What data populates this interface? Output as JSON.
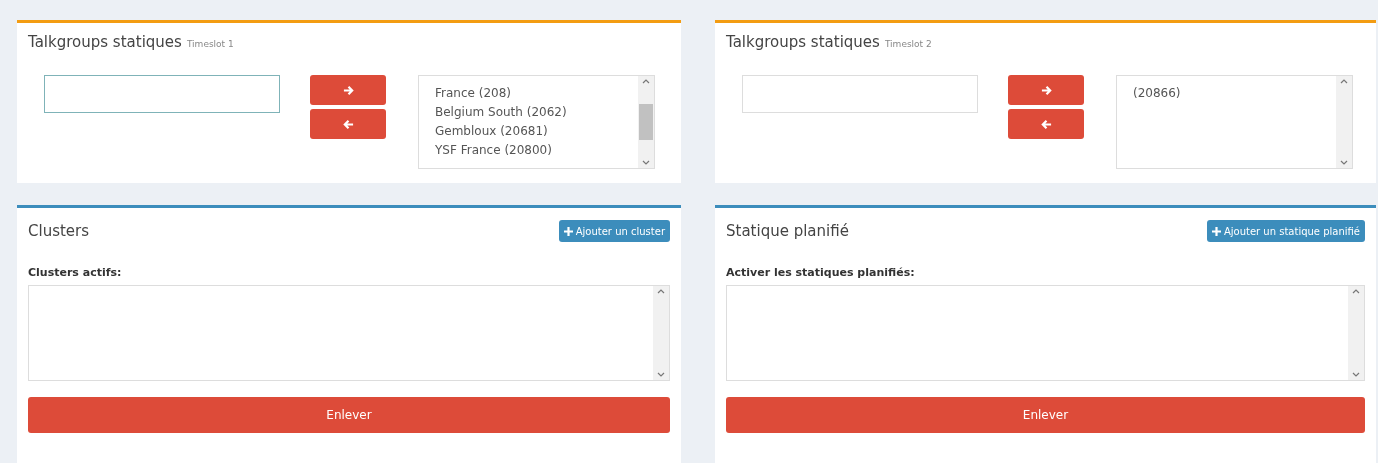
{
  "talkgroup_panels": [
    {
      "title": "Talkgroups statiques",
      "subtitle": "Timeslot 1",
      "input": {
        "focused": true
      },
      "list": {
        "items": [
          "France (208)",
          "Belgium South (2062)",
          "Gembloux (20681)",
          "YSF France (20800)"
        ],
        "overflow": true
      }
    },
    {
      "title": "Talkgroups statiques",
      "subtitle": "Timeslot 2",
      "input": {
        "focused": false
      },
      "list": {
        "items": [
          "(20866)"
        ],
        "overflow": false
      }
    }
  ],
  "bottom_panels": [
    {
      "title": "Clusters",
      "add_button": "Ajouter un cluster",
      "label": "Clusters actifs:",
      "remove_button": "Enlever"
    },
    {
      "title": "Statique planifié",
      "add_button": "Ajouter un statique planifié",
      "label": "Activer les statiques planifiés:",
      "remove_button": "Enlever"
    }
  ]
}
